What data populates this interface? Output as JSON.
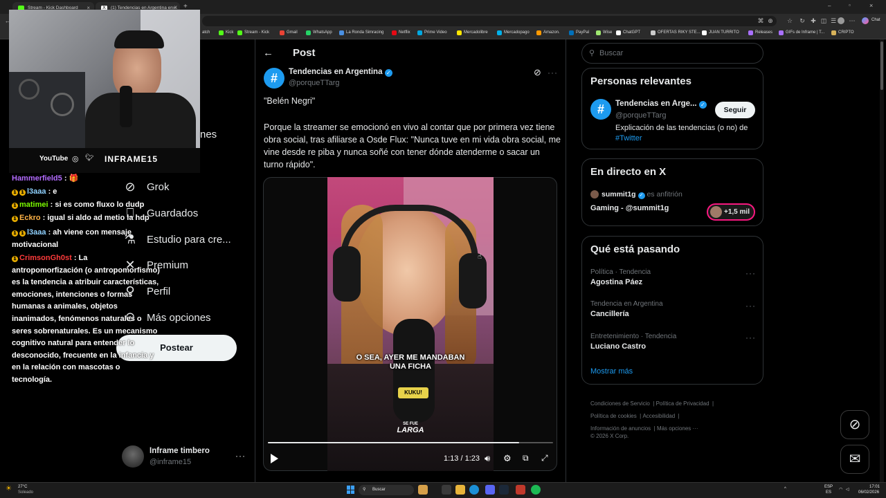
{
  "browser": {
    "tabs": [
      {
        "title": "Stream - Kick Dashboard",
        "color": "#53fc18"
      },
      {
        "title": "(1) Tendencias en Argentina en X",
        "color": "#ffffff"
      }
    ],
    "new_tab": "+",
    "chat_button": "Chat",
    "bookmarks": [
      {
        "label": "atch",
        "color": "#a970ff"
      },
      {
        "label": "Kick",
        "color": "#53fc18"
      },
      {
        "label": "Stream - Kick",
        "color": "#53fc18"
      },
      {
        "label": "Gmail",
        "color": "#ea4335"
      },
      {
        "label": "WhatsApp",
        "color": "#25d366"
      },
      {
        "label": "La Ronda Simracing",
        "color": "#4a90e2"
      },
      {
        "label": "Netflix",
        "color": "#e50914"
      },
      {
        "label": "Prime Video",
        "color": "#00a8e1"
      },
      {
        "label": "Mercadolibre",
        "color": "#ffe600"
      },
      {
        "label": "Mercadopago",
        "color": "#00b1ea"
      },
      {
        "label": "Amazon.",
        "color": "#ff9900"
      },
      {
        "label": "PayPal",
        "color": "#0070ba"
      },
      {
        "label": "Wise",
        "color": "#9fe870"
      },
      {
        "label": "ChatGPT",
        "color": "#ffffff"
      },
      {
        "label": "OFERTAS RIKY STE...",
        "color": "#cccccc"
      },
      {
        "label": "JUAN TURRITO",
        "color": "#ffffff"
      },
      {
        "label": "Releases",
        "color": "#a970ff"
      },
      {
        "label": "GIFs de Inframe | T...",
        "color": "#a970ff"
      },
      {
        "label": "CRIPTO",
        "color": "#d8b25a"
      }
    ]
  },
  "webcam": {
    "youtube": "YouTube",
    "handle": "INFRAME15"
  },
  "nav": {
    "hidden_partial": "nes",
    "items": [
      {
        "label": "Grok",
        "icon": "grok-icon"
      },
      {
        "label": "Guardados",
        "icon": "bookmark-icon"
      },
      {
        "label": "Estudio para cre...",
        "icon": "flask-icon"
      },
      {
        "label": "Premium",
        "icon": "x-logo-icon"
      },
      {
        "label": "Perfil",
        "icon": "person-icon"
      },
      {
        "label": "Más opciones",
        "icon": "more-circle-icon"
      }
    ],
    "post_button": "Postear",
    "account": {
      "name": "Inframe timbero",
      "handle": "@inframe15",
      "more": "···"
    }
  },
  "chat": [
    {
      "user": "Hammerfield5",
      "color": "#b36bff",
      "text": " : 🎁",
      "badges": 0
    },
    {
      "user": "l3aaa",
      "color": "#8fd1ff",
      "text": " : e",
      "badges": 2
    },
    {
      "user": "matimei",
      "color": "#7cfc00",
      "text": " : si es como fluxo lo dudp",
      "badges": 1
    },
    {
      "user": "Eckro",
      "color": "#ffb347",
      "text": " : igual si aldo ad metio la hdp",
      "badges": 1
    },
    {
      "user": "l3aaa",
      "color": "#8fd1ff",
      "text": " : ah viene con mensaje motivacional",
      "badges": 2
    },
    {
      "user": "CrimsonGh0st",
      "color": "#ff3b3b",
      "text": " : La antropomorfización (o antropomorfismo) es la tendencia a atribuir características, emociones, intenciones o formas humanas a animales, objetos inanimados, fenómenos naturales o seres sobrenaturales. Es un mecanismo cognitivo natural para entender lo desconocido, frecuente en la infancia y en la relación con mascotas o tecnología.",
      "badges": 1
    }
  ],
  "post": {
    "header_title": "Post",
    "author_name": "Tendencias en Argentina",
    "author_handle": "@porqueTTarg",
    "title_line": "\"Belén Negri\"",
    "body": "Porque la streamer se emocionó en vivo al contar que por primera vez tiene obra social, tras afiliarse a Osde Flux: \"Nunca tuve en mi vida obra social, me vine desde re piba y nunca soñé con tener dónde atenderme o sacar un turno rápido\".",
    "more": "···",
    "video": {
      "subtitle_line1": "O SEA, AYER ME MANDABAN",
      "subtitle_line2": "UNA FICHA",
      "mic_brand": "KUKU!",
      "show_logo_top": "SE FUE",
      "show_logo_bottom": "LARGA",
      "time": "1:13 / 1:23",
      "progress": 0.88
    }
  },
  "right": {
    "search_placeholder": "Buscar",
    "relevant": {
      "title": "Personas relevantes",
      "name": "Tendencias en Arge...",
      "handle": "@porqueTTarg",
      "follow": "Seguir",
      "bio": "Explicación de las tendencias (o no) de",
      "bio_link": "#Twitter"
    },
    "live": {
      "title": "En directo en X",
      "host": "summit1g",
      "host_role": "es anfitrión",
      "show": "Gaming - @summit1g",
      "listeners": "+1,5 mil"
    },
    "happening": {
      "title": "Qué está pasando",
      "trends": [
        {
          "meta": "Política · Tendencia",
          "name": "Agostina Páez"
        },
        {
          "meta": "Tendencia en Argentina",
          "name": "Cancillería"
        },
        {
          "meta": "Entretenimiento · Tendencia",
          "name": "Luciano Castro"
        }
      ],
      "show_more": "Mostrar más"
    },
    "footer": {
      "line1": [
        "Condiciones de Servicio",
        "Política de Privacidad"
      ],
      "line2": [
        "Política de cookies",
        "Accesibilidad"
      ],
      "line3": [
        "Información de anuncios",
        "Más opciones ···"
      ],
      "copyright": "© 2026 X Corp."
    }
  },
  "taskbar": {
    "weather_temp": "27°C",
    "weather_desc": "Soleado",
    "search": "Buscar",
    "lang": "ESP",
    "lang2": "ES",
    "time": "17:01",
    "date": "06/02/2026"
  },
  "colors": {
    "accent": "#1d9bf0",
    "verified": "#1d9bf0",
    "live_ring": "#f91880"
  }
}
